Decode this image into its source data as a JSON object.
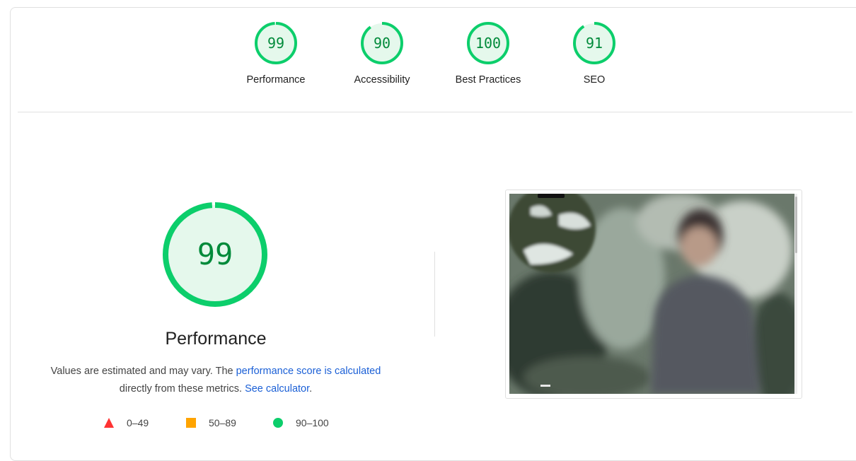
{
  "summary_gauges": [
    {
      "score": "99",
      "label": "Performance",
      "fraction": 0.99
    },
    {
      "score": "90",
      "label": "Accessibility",
      "fraction": 0.9
    },
    {
      "score": "100",
      "label": "Best Practices",
      "fraction": 1.0
    },
    {
      "score": "91",
      "label": "SEO",
      "fraction": 0.91
    }
  ],
  "performance": {
    "score": "99",
    "fraction": 0.99,
    "title": "Performance",
    "desc_prefix": "Values are estimated and may vary. The ",
    "desc_link1": "performance score is calculated",
    "desc_middle": " directly from these metrics. ",
    "desc_link2": "See calculator",
    "desc_suffix": "."
  },
  "legend": {
    "fail": "0–49",
    "average": "50–89",
    "pass": "90–100"
  },
  "colors": {
    "pass": "#0cce6b",
    "pass_fill": "#e5f8ec",
    "pass_text": "#008a3a",
    "average": "#ffa400",
    "fail": "#ff3333",
    "link": "#1a5fd6"
  },
  "screenshot": {
    "description_icon": "page-screenshot-thumbnail"
  }
}
